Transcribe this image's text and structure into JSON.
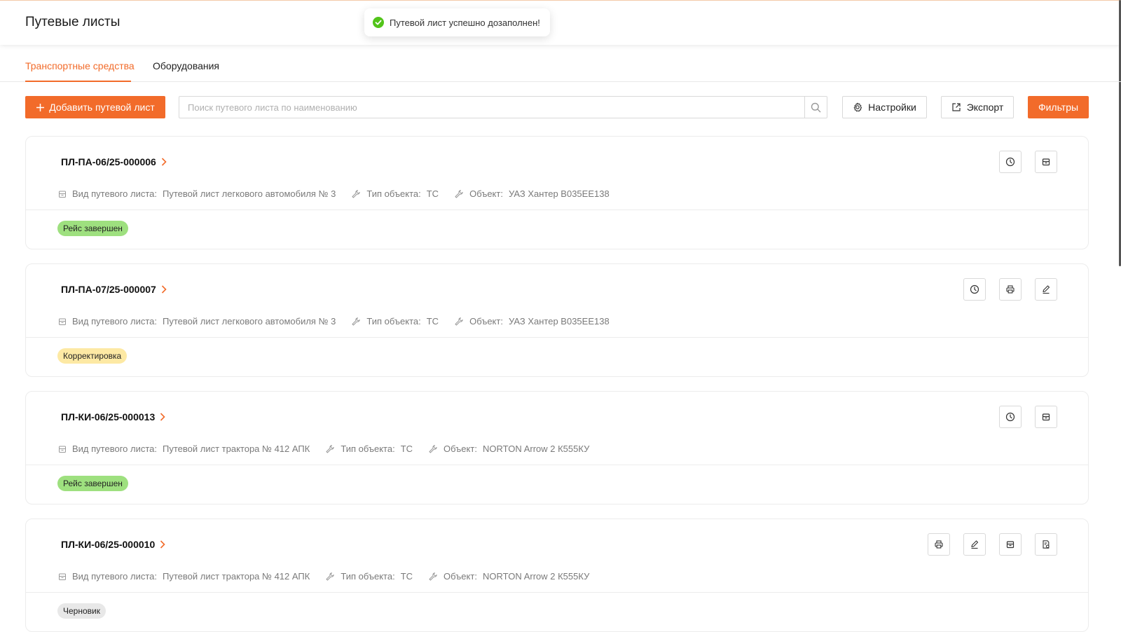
{
  "header": {
    "title": "Путевые листы"
  },
  "toast": {
    "message": "Путевой лист успешно дозаполнен!",
    "status_color": "#52c41a"
  },
  "tabs": [
    {
      "label": "Транспортные средства",
      "active": true
    },
    {
      "label": "Оборудования",
      "active": false
    }
  ],
  "toolbar": {
    "add_label": "Добавить путевой лист",
    "search_placeholder": "Поиск путевого листа по наименованию",
    "search_value": "",
    "settings_label": "Настройки",
    "export_label": "Экспорт",
    "filters_label": "Фильтры"
  },
  "labels": {
    "sheet_type": "Вид путевого листа:",
    "object_type": "Тип объекта:",
    "object": "Объект:"
  },
  "cards": [
    {
      "number": "ПЛ-ПА-06/25-000006",
      "sheet_type": "Путевой лист легкового автомобиля № 3",
      "object_type": "ТС",
      "object": "УАЗ Хантер В035ЕЕ138",
      "status": "Рейс завершен",
      "actions": [
        "clock-icon",
        "archive-icon"
      ]
    },
    {
      "number": "ПЛ-ПА-07/25-000007",
      "sheet_type": "Путевой лист легкового автомобиля № 3",
      "object_type": "ТС",
      "object": "УАЗ Хантер В035ЕЕ138",
      "status": "Корректировка",
      "actions": [
        "clock-icon",
        "printer-icon",
        "edit-icon"
      ]
    },
    {
      "number": "ПЛ-КИ-06/25-000013",
      "sheet_type": "Путевой лист трактора № 412 АПК",
      "object_type": "ТС",
      "object": "NORTON Arrow 2 К555КУ",
      "status": "Рейс завершен",
      "actions": [
        "clock-icon",
        "archive-icon"
      ]
    },
    {
      "number": "ПЛ-КИ-06/25-000010",
      "sheet_type": "Путевой лист трактора № 412 АПК",
      "object_type": "ТС",
      "object": "NORTON Arrow 2 К555КУ",
      "status": "Черновик",
      "actions": [
        "printer-icon",
        "edit-icon",
        "archive-icon",
        "document-settings-icon"
      ]
    }
  ],
  "colors": {
    "accent": "#f26b2a",
    "status_done": "#9ee07f",
    "status_correction": "#fde9a4",
    "status_draft": "#e8e8e8"
  }
}
